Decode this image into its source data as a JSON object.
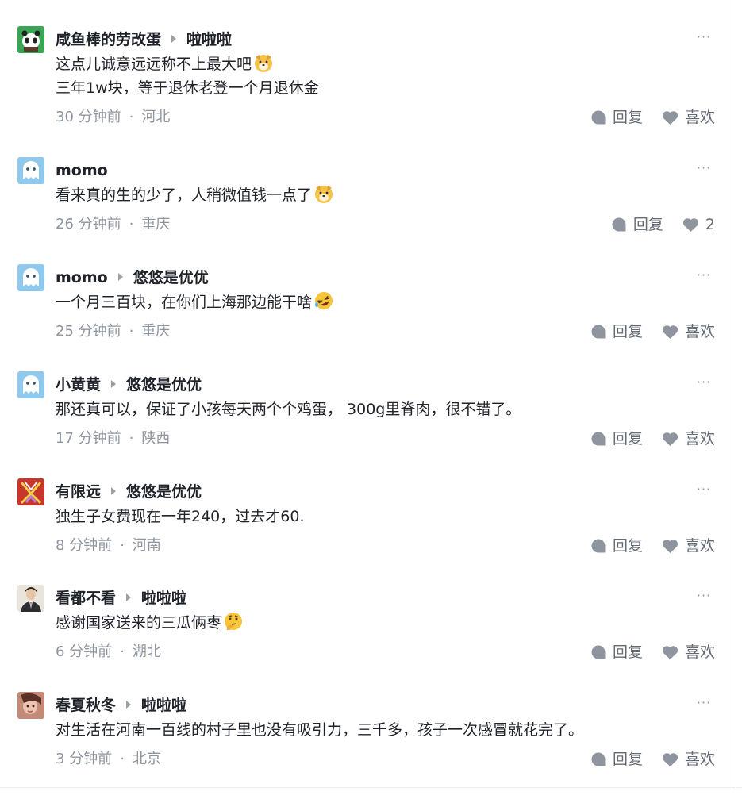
{
  "comments": [
    {
      "user": "咸鱼棒的劳改蛋",
      "reply_to": "啦啦啦",
      "lines": [
        "这点儿诚意远远称不上最大吧",
        "三年1w块，等于退休老登一个月退休金"
      ],
      "emoji": "dog-face-emoji",
      "time": "30 分钟前",
      "location": "河北",
      "reply_label": "回复",
      "like_label": "喜欢",
      "avatar": "panda-avatar"
    },
    {
      "user": "momo",
      "reply_to": "",
      "lines": [
        "看来真的生的少了，人稍微值钱一点了"
      ],
      "emoji": "dog-face-emoji",
      "time": "26 分钟前",
      "location": "重庆",
      "reply_label": "回复",
      "like_label": "2",
      "avatar": "blue-ghost-avatar"
    },
    {
      "user": "momo",
      "reply_to": "悠悠是优优",
      "lines": [
        "一个月三百块，在你们上海那边能干啥"
      ],
      "emoji": "rolling-laughing-emoji",
      "time": "25 分钟前",
      "location": "重庆",
      "reply_label": "回复",
      "like_label": "喜欢",
      "avatar": "blue-ghost-avatar"
    },
    {
      "user": "小黄黄",
      "reply_to": "悠悠是优优",
      "lines": [
        "那还真可以，保证了小孩每天两个个鸡蛋， 300g里脊肉，很不错了。"
      ],
      "emoji": "",
      "time": "17 分钟前",
      "location": "陕西",
      "reply_label": "回复",
      "like_label": "喜欢",
      "avatar": "blue-ghost-avatar"
    },
    {
      "user": "有限远",
      "reply_to": "悠悠是优优",
      "lines": [
        "独生子女费现在一年240，过去才60."
      ],
      "emoji": "",
      "time": "8 分钟前",
      "location": "河南",
      "reply_label": "回复",
      "like_label": "喜欢",
      "avatar": "red-x-avatar"
    },
    {
      "user": "看都不看",
      "reply_to": "啦啦啦",
      "lines": [
        "感谢国家送来的三瓜俩枣"
      ],
      "emoji": "thinking-face-emoji",
      "time": "6 分钟前",
      "location": "湖北",
      "reply_label": "回复",
      "like_label": "喜欢",
      "avatar": "man-suit-avatar"
    },
    {
      "user": "春夏秋冬",
      "reply_to": "啦啦啦",
      "lines": [
        "对生活在河南一百线的村子里也没有吸引力，三千多，孩子一次感冒就花完了。"
      ],
      "emoji": "",
      "time": "3 分钟前",
      "location": "北京",
      "reply_label": "回复",
      "like_label": "喜欢",
      "avatar": "photo-avatar"
    }
  ],
  "more_label": "···",
  "meta_separator": "·",
  "colors": {
    "name": "#1f2329",
    "meta": "#8f959e",
    "action": "#646a73",
    "icon": "#8f959e"
  }
}
